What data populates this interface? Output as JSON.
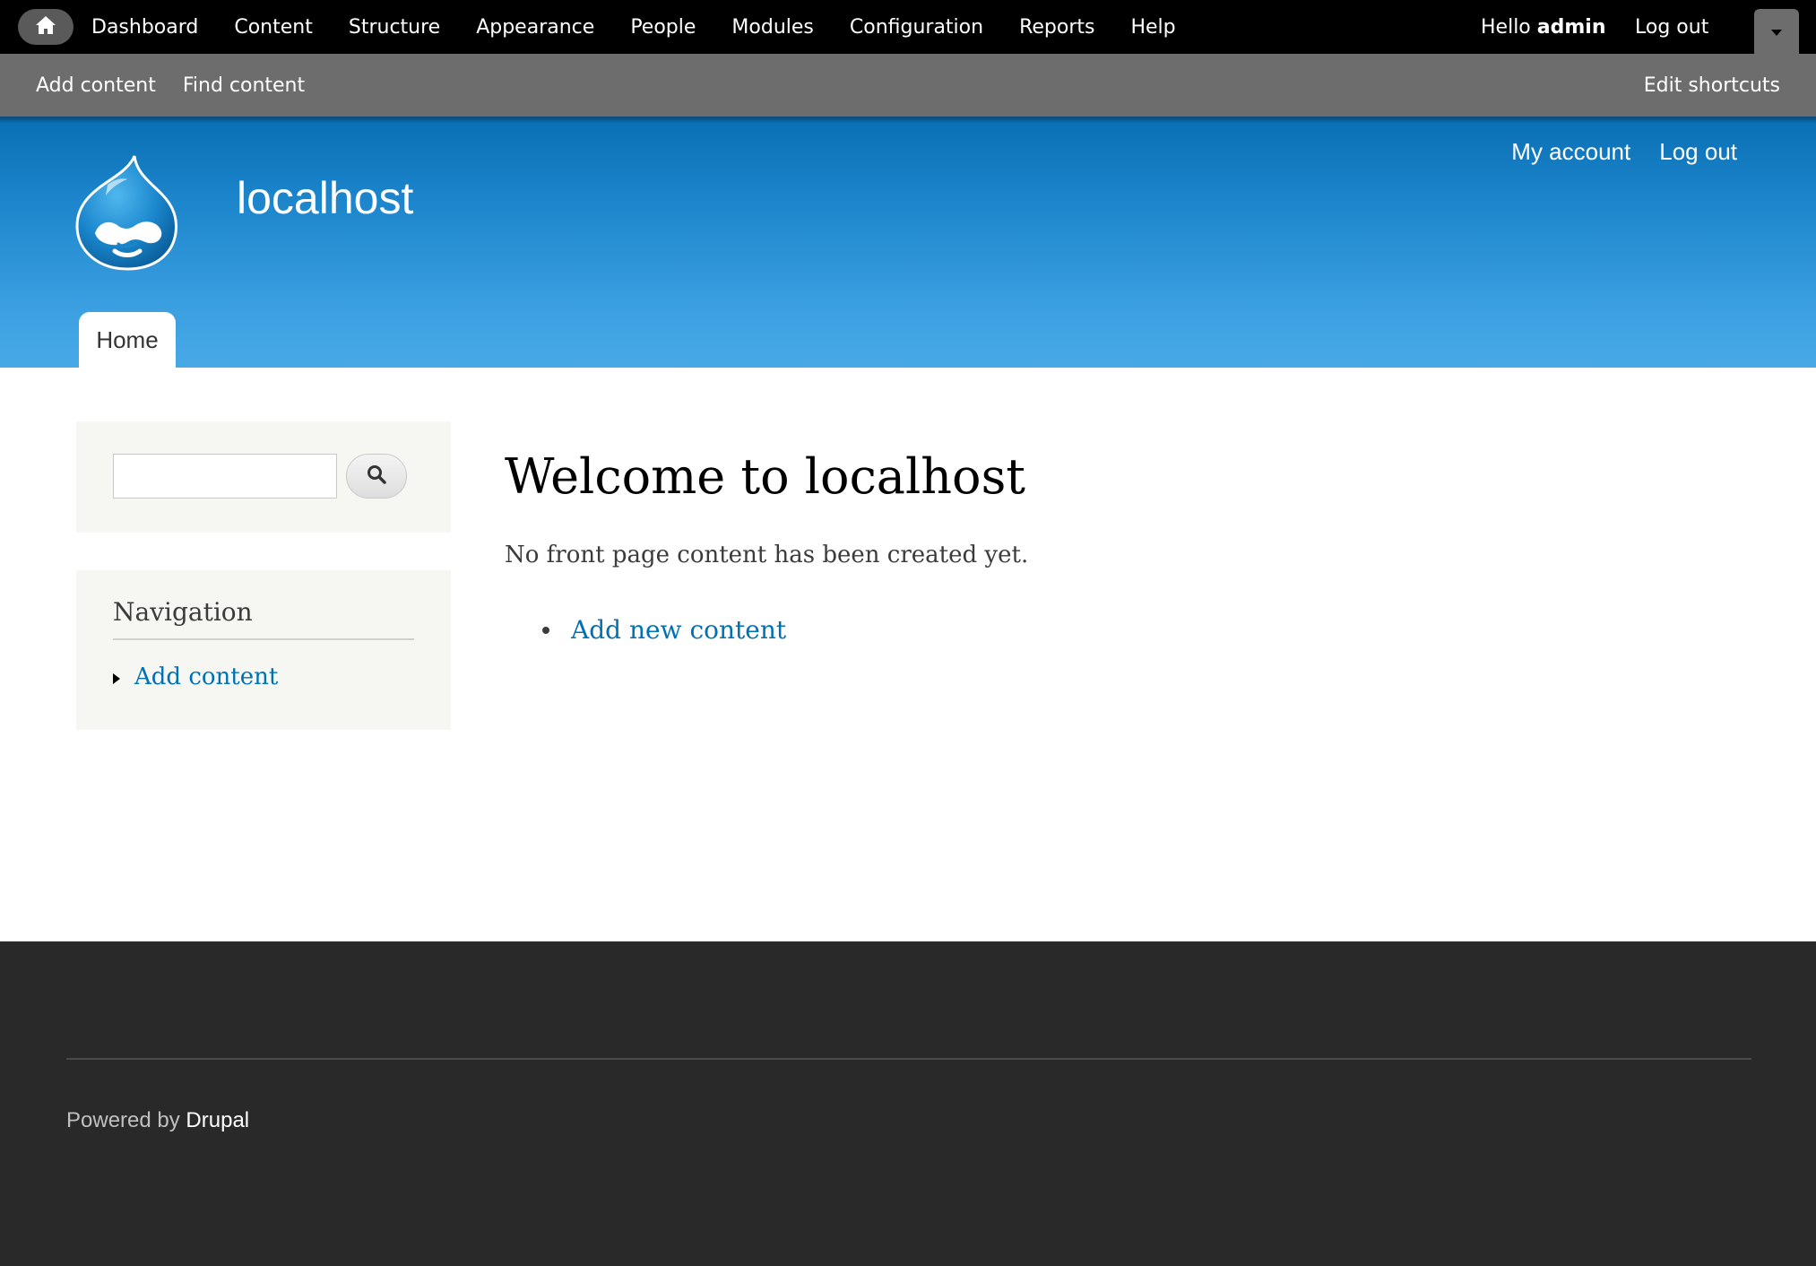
{
  "toolbar": {
    "home_icon": "home-icon",
    "menu": [
      "Dashboard",
      "Content",
      "Structure",
      "Appearance",
      "People",
      "Modules",
      "Configuration",
      "Reports",
      "Help"
    ],
    "greeting": "Hello",
    "username": "admin",
    "logout": "Log out",
    "drawer_icon": "chevron-down-icon"
  },
  "shortcuts": {
    "items": [
      "Add content",
      "Find content"
    ],
    "edit": "Edit shortcuts"
  },
  "header": {
    "site_name": "localhost",
    "logo_icon": "drupal-drop-logo",
    "secondary_menu": [
      "My account",
      "Log out"
    ],
    "main_tab": "Home"
  },
  "sidebar": {
    "search": {
      "value": "",
      "button_icon": "search-icon"
    },
    "navigation": {
      "title": "Navigation",
      "items": [
        "Add content"
      ]
    }
  },
  "main": {
    "title": "Welcome to localhost",
    "intro": "No front page content has been created yet.",
    "links": [
      "Add new content"
    ]
  },
  "footer": {
    "powered_prefix": "Powered by",
    "powered_link": "Drupal"
  },
  "colors": {
    "toolbar_bg": "#000000",
    "shortcuts_bg": "#6d6d6d",
    "header_top": "#0a6fb5",
    "header_bottom": "#48a9e6",
    "link": "#0071b3",
    "footer_bg": "#292929",
    "sidebar_block_bg": "#f6f6f2"
  }
}
